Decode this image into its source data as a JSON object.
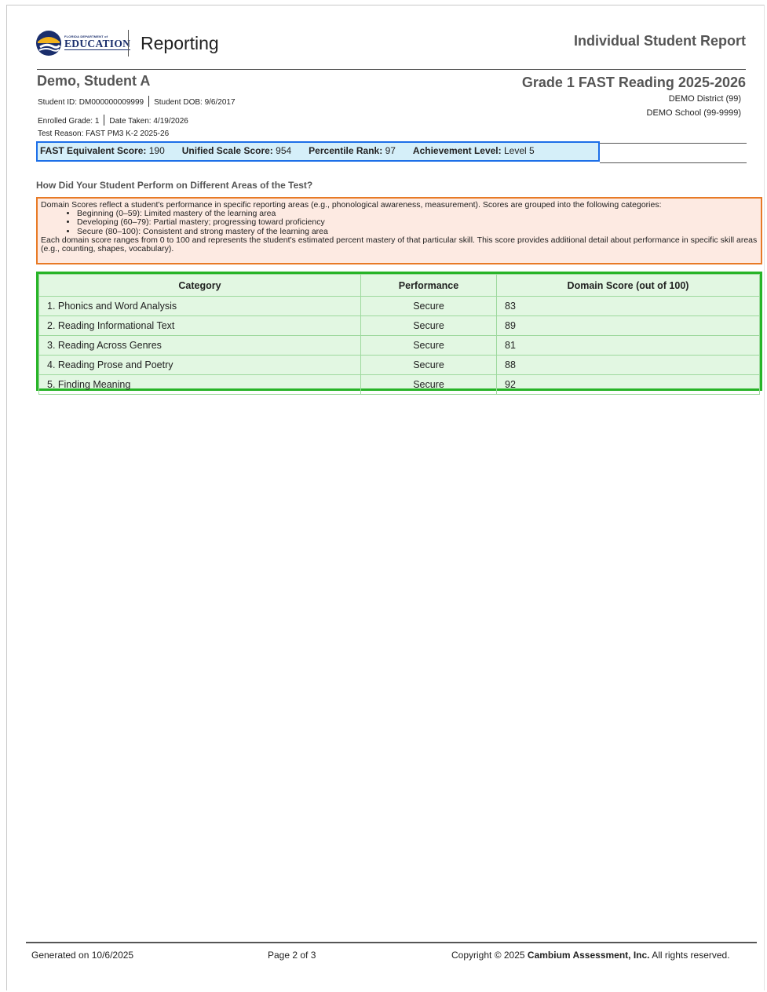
{
  "header": {
    "logo_small_text": "FLORIDA DEPARTMENT of",
    "logo_main_text": "EDUCATION",
    "app_title": "Reporting",
    "report_title": "Individual Student Report"
  },
  "student": {
    "name": "Demo, Student A",
    "id_label": "Student ID: DM000000009999",
    "dob_label": "Student DOB: 9/6/2017",
    "enrolled_label": "Enrolled Grade: 1",
    "date_taken_label": "Date Taken: 4/19/2026",
    "test_reason_label": "Test Reason: FAST PM3 K-2 2025-26"
  },
  "test": {
    "title": "Grade 1 FAST Reading 2025-2026",
    "district": "DEMO District (99)",
    "school": "DEMO School (99-9999)"
  },
  "scores": {
    "fast_label": "FAST Equivalent Score:",
    "fast_value": "190",
    "unified_label": "Unified Scale Score:",
    "unified_value": "954",
    "percentile_label": "Percentile Rank:",
    "percentile_value": "97",
    "achievement_label": "Achievement Level:",
    "achievement_value": "Level 5"
  },
  "section_heading": "How Did Your Student Perform on Different Areas of the Test?",
  "domain_info": {
    "intro": "Domain Scores reflect a student's performance in specific reporting areas (e.g., phonological awareness, measurement). Scores are grouped into the following categories:",
    "categories": [
      "Beginning (0–59): Limited mastery of the learning area",
      "Developing (60–79): Partial mastery; progressing toward proficiency",
      "Secure (80–100): Consistent and strong mastery of the learning area"
    ],
    "outro": "Each domain score ranges from 0 to 100 and represents the student's estimated percent mastery of that particular skill. This score provides additional detail about performance in specific skill areas (e.g., counting, shapes, vocabulary)."
  },
  "table": {
    "headers": [
      "Category",
      "Performance",
      "Domain Score (out of 100)"
    ],
    "rows": [
      {
        "category": "1. Phonics and Word Analysis",
        "performance": "Secure",
        "score": "83"
      },
      {
        "category": "2. Reading Informational Text",
        "performance": "Secure",
        "score": "89"
      },
      {
        "category": "3. Reading Across Genres",
        "performance": "Secure",
        "score": "81"
      },
      {
        "category": "4. Reading Prose and Poetry",
        "performance": "Secure",
        "score": "88"
      },
      {
        "category": "5. Finding Meaning",
        "performance": "Secure",
        "score": "92"
      }
    ]
  },
  "footer": {
    "generated": "Generated on 10/6/2025",
    "page": "Page 2 of 3",
    "copyright_prefix": "Copyright © 2025 ",
    "copyright_company": "Cambium Assessment, Inc.",
    "copyright_suffix": " All rights reserved."
  },
  "colors": {
    "score_box_border": "#1d6fe8",
    "domain_box_border": "#e87a26",
    "table_border": "#27b427"
  }
}
